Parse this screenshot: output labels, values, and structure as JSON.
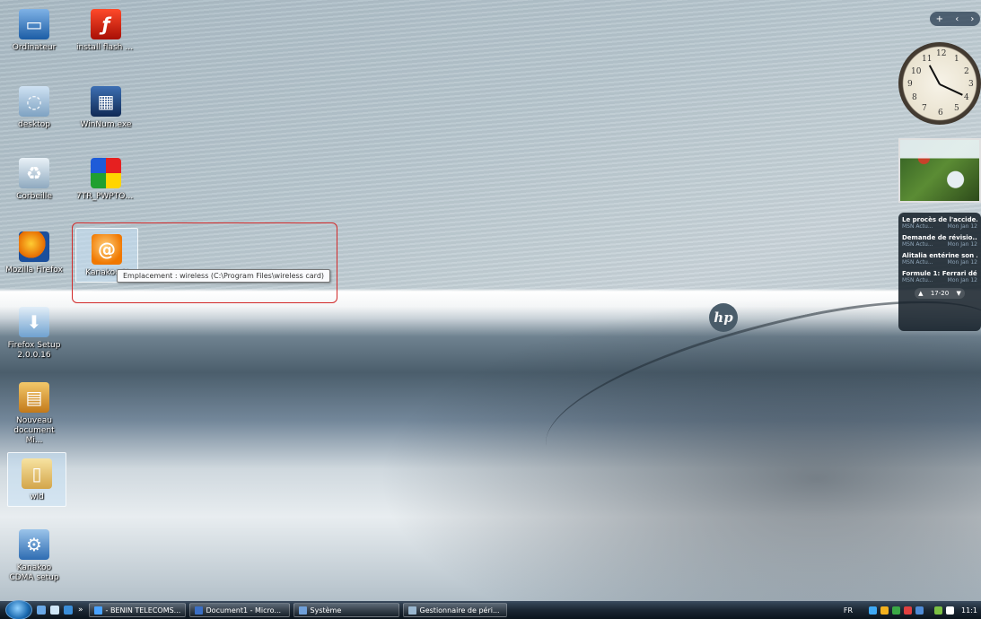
{
  "desktop_icons": [
    {
      "label": "Ordinateur",
      "icon": "computer-icon"
    },
    {
      "label": "install flash pl...",
      "icon": "flash-installer-icon"
    },
    {
      "label": "desktop",
      "icon": "desktop-file-icon"
    },
    {
      "label": "WinNum.exe",
      "icon": "winnum-exe-icon"
    },
    {
      "label": "Corbeille",
      "icon": "recycle-bin-icon"
    },
    {
      "label": "7TR_PWPTOOl...",
      "icon": "color-balls-icon"
    },
    {
      "label": "Mozilla Firefox",
      "icon": "firefox-icon"
    },
    {
      "label": "Kanakoo C",
      "icon": "kanakoo-icon"
    },
    {
      "label": "Firefox Setup 2.0.0.16",
      "icon": "firefox-setup-icon"
    },
    {
      "label": "Nouveau document Mi...",
      "icon": "word-document-icon"
    },
    {
      "label": "wld",
      "icon": "folder-icon"
    },
    {
      "label": "Kanakoo CDMA setup",
      "icon": "kanakoo-setup-icon"
    }
  ],
  "tooltip": "Emplacement : wireless (C:\\Program Files\\wireless card)",
  "wallpaper_logo": "hp",
  "sidebar": {
    "controls": {
      "add": "+",
      "prev": "‹",
      "next": "›"
    },
    "clock_numbers": [
      "12",
      "1",
      "2",
      "3",
      "4",
      "5",
      "6",
      "7",
      "8",
      "9",
      "10",
      "11"
    ],
    "news": [
      {
        "headline": "Le procès de l'accide...",
        "source": "MSN Actu...",
        "date": "Mon Jan 12"
      },
      {
        "headline": "Demande de révisio...",
        "source": "MSN Actu...",
        "date": "Mon Jan 12"
      },
      {
        "headline": "Alitalia entérine son ...",
        "source": "MSN Actu...",
        "date": "Mon Jan 12"
      },
      {
        "headline": "Formule 1: Ferrari dé...",
        "source": "MSN Actu...",
        "date": "Mon Jan 12"
      }
    ],
    "pager": "17-20"
  },
  "taskbar": {
    "overflow": "»",
    "buttons": [
      {
        "label": "- BENIN TELECOMS...",
        "icon": "ie-icon",
        "color": "#4aa3ff"
      },
      {
        "label": "Document1 - Micro...",
        "icon": "word-icon",
        "color": "#3b6fc4"
      },
      {
        "label": "Système",
        "icon": "system-icon",
        "color": "#6f9fd8"
      },
      {
        "label": "Gestionnaire de péri...",
        "icon": "device-manager-icon",
        "color": "#9ab7cf"
      }
    ],
    "tray": {
      "language": "FR",
      "time": "11:1",
      "icon_colors": [
        "#3fa9f5",
        "#f2b01e",
        "#3aa845",
        "#e04040",
        "#4f8bd6",
        "#7bc043",
        "#ffffff"
      ]
    }
  },
  "colors": {
    "tooltip_highlight": "#d22a2a",
    "taskbar": "#1b2733"
  }
}
